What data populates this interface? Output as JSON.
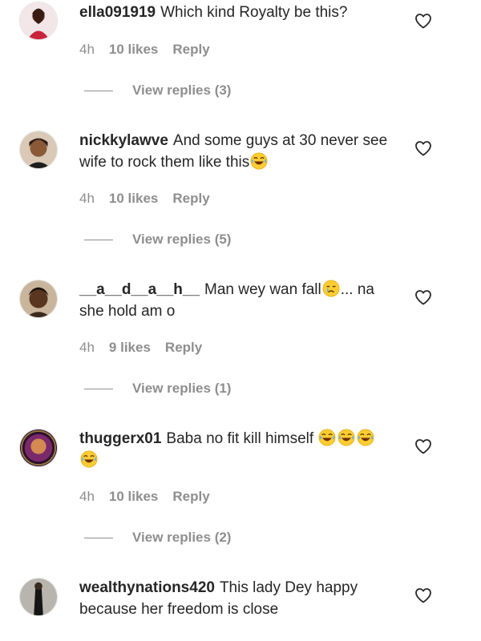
{
  "comments": [
    {
      "username": "ella091919",
      "text": "Which kind Royalty be this?",
      "time": "4h",
      "likes": "10 likes",
      "reply": "Reply",
      "view_replies": "View replies (3)"
    },
    {
      "username": "nickkylawve",
      "text": "And some guys at 30 never see wife to rock them like this",
      "time": "4h",
      "likes": "10 likes",
      "reply": "Reply",
      "view_replies": "View replies (5)"
    },
    {
      "username": "__a__d__a__h__",
      "text_before_emoji": "Man wey wan fall",
      "text_after_emoji": "... na she hold am o",
      "time": "4h",
      "likes": "9 likes",
      "reply": "Reply",
      "view_replies": "View replies (1)"
    },
    {
      "username": "thuggerx01",
      "text": "Baba no fit kill himself",
      "time": "4h",
      "likes": "10 likes",
      "reply": "Reply",
      "view_replies": "View replies (2)"
    },
    {
      "username": "wealthynations420",
      "text": "This lady Dey happy because her freedom is close"
    }
  ],
  "icons": {
    "like": "heart-outline-icon",
    "laugh_emoji": "face-with-tears-of-joy-emoji",
    "crying_emoji": "crying-face-emoji"
  },
  "colors": {
    "text": "#262626",
    "secondary": "#8e8e8e"
  }
}
